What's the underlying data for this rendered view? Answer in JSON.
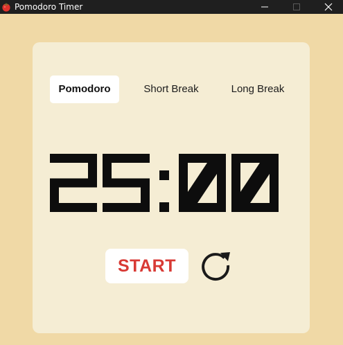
{
  "window": {
    "title": "Pomodoro Timer",
    "icon": "tomato-icon"
  },
  "tabs": [
    {
      "label": "Pomodoro",
      "active": true
    },
    {
      "label": "Short Break",
      "active": false
    },
    {
      "label": "Long Break",
      "active": false
    }
  ],
  "timer": {
    "display": "25:00"
  },
  "controls": {
    "start_label": "START",
    "reset_icon": "restart-icon"
  },
  "colors": {
    "background": "#f0d9a6",
    "card": "#f5edd4",
    "accent": "#d83a35",
    "titlebar": "#1f1f1f"
  }
}
